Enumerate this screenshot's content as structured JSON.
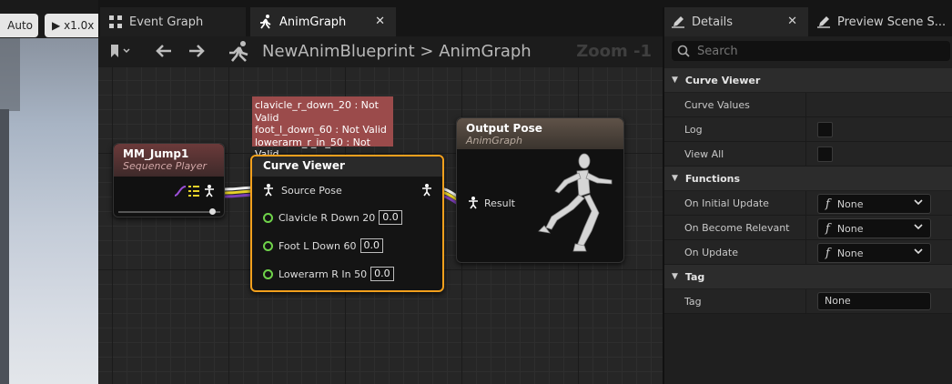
{
  "viewport": {
    "auto_label": "Auto",
    "play_label": "x1.0x"
  },
  "tabs": [
    {
      "label": "Event Graph"
    },
    {
      "label": "AnimGraph"
    }
  ],
  "graph": {
    "breadcrumb_root": "NewAnimBlueprint",
    "breadcrumb_sep": ">",
    "breadcrumb_current": "AnimGraph",
    "zoom_label": "Zoom -1"
  },
  "nodes": {
    "sequence_player": {
      "title": "MM_Jump1",
      "subtitle": "Sequence Player"
    },
    "curve_viewer": {
      "title": "Curve Viewer",
      "source_pose": "Source Pose",
      "pins": [
        {
          "label": "Clavicle R Down 20",
          "value": "0.0"
        },
        {
          "label": "Foot L Down 60",
          "value": "0.0"
        },
        {
          "label": "Lowerarm R In 50",
          "value": "0.0"
        }
      ]
    },
    "output_pose": {
      "title": "Output Pose",
      "subtitle": "AnimGraph",
      "result_label": "Result"
    }
  },
  "error_lines": [
    "clavicle_r_down_20 : Not Valid",
    "foot_l_down_60 : Not Valid",
    "lowerarm_r_in_50 : Not Valid"
  ],
  "details": {
    "tab_details": "Details",
    "tab_preview": "Preview Scene S...",
    "search_placeholder": "Search",
    "categories": {
      "curve_viewer": "Curve Viewer",
      "functions": "Functions",
      "tag": "Tag"
    },
    "curve_values_label": "Curve Values",
    "log_label": "Log",
    "view_all_label": "View All",
    "on_initial_update_label": "On Initial Update",
    "on_become_relevant_label": "On Become Relevant",
    "on_update_label": "On Update",
    "function_value": "None",
    "tag_label": "Tag",
    "tag_value": "None"
  },
  "colors": {
    "selection_outline": "#f2a01d",
    "error_background": "#9b4b4b",
    "curve_pin": "#6fd34a"
  }
}
